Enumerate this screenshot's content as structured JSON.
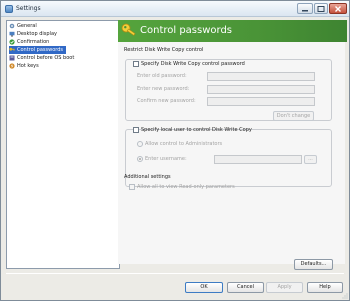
{
  "window": {
    "title": "Settings"
  },
  "tree": {
    "items": [
      {
        "label": "General",
        "icon": "gear-icon",
        "color": "#6b8fb6"
      },
      {
        "label": "Desktop display",
        "icon": "display-icon",
        "color": "#4b7fc0"
      },
      {
        "label": "Confirmation",
        "icon": "confirm-icon",
        "color": "#3a9c3a"
      },
      {
        "label": "Control passwords",
        "icon": "key-icon",
        "color": "#e0b52a",
        "selected": true
      },
      {
        "label": "Control before OS boot",
        "icon": "boot-icon",
        "color": "#5a5a9a"
      },
      {
        "label": "Hot keys",
        "icon": "hotkey-icon",
        "color": "#d08a2c"
      }
    ]
  },
  "panel": {
    "title": "Control passwords",
    "accent": "#4a9437",
    "section_restrict": "Restrict Disk Write Copy control",
    "specify_password_label": "Specify Disk Write Copy control password",
    "old_password_label": "Enter old password:",
    "new_password_label": "Enter new password:",
    "confirm_password_label": "Confirm new password:",
    "dont_change_label": "Don't change",
    "specify_local_user_label": "Specify local user to control Disk Write Copy",
    "allow_admins_label": "Allow control to Administrators",
    "enter_username_label": "Enter username:",
    "browse_label": "...",
    "additional_settings": "Additional settings",
    "allow_readonly_label": "Allow all to view Read-only parameters",
    "defaults_label": "Defaults..."
  },
  "footer": {
    "ok_label": "OK",
    "cancel_label": "Cancel",
    "apply_label": "Apply",
    "help_label": "Help"
  }
}
